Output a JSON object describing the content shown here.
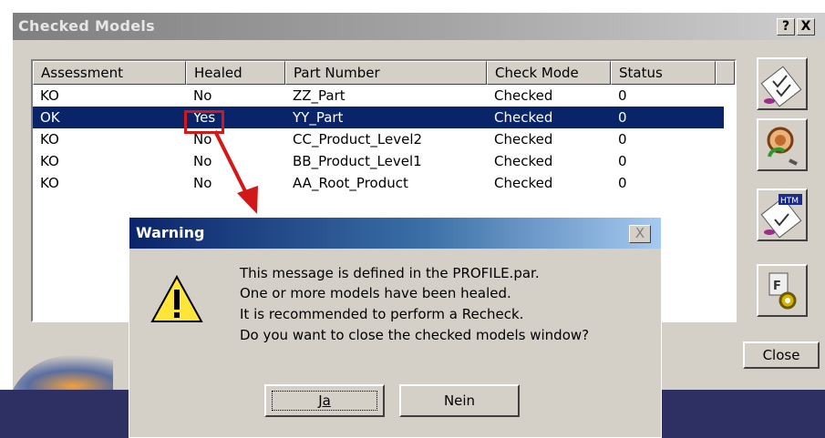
{
  "main_window": {
    "title": "Checked Models",
    "help_button": "?",
    "close_button": "X",
    "close_label": "Close"
  },
  "list": {
    "columns": [
      "Assessment",
      "Healed",
      "Part Number",
      "Check Mode",
      "Status"
    ],
    "rows": [
      [
        "KO",
        "No",
        "ZZ_Part",
        "Checked",
        "0"
      ],
      [
        "OK",
        "Yes",
        "YY_Part",
        "Checked",
        "0"
      ],
      [
        "KO",
        "No",
        "CC_Product_Level2",
        "Checked",
        "0"
      ],
      [
        "KO",
        "No",
        "BB_Product_Level1",
        "Checked",
        "0"
      ],
      [
        "KO",
        "No",
        "AA_Root_Product",
        "Checked",
        "0"
      ]
    ],
    "selected_row": 1
  },
  "warning": {
    "title": "Warning",
    "close_glyph": "X",
    "lines": [
      "This message is defined in the PROFILE.par.",
      " One or more models have been healed.",
      " It is recommended to perform a Recheck.",
      " Do you want to close the checked models window?"
    ],
    "yes_label": "Ja",
    "no_label": "Nein"
  },
  "side_buttons": [
    "check-report-icon",
    "recheck-icon",
    "html-report-icon",
    "settings-icon"
  ],
  "colors": {
    "selection": "#0a246a",
    "highlight": "#d21919",
    "dialog_face": "#d4d0c8"
  }
}
